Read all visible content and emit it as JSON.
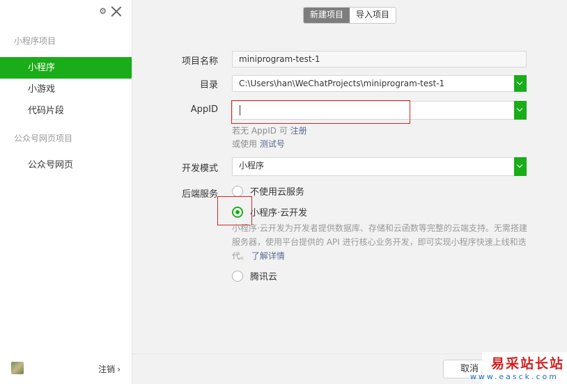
{
  "sidebar": {
    "gear_icon": "⚙",
    "sections": [
      {
        "title": "小程序项目",
        "items": [
          "小程序",
          "小游戏",
          "代码片段"
        ]
      },
      {
        "title": "公众号网页项目",
        "items": [
          "公众号网页"
        ]
      }
    ],
    "active_item": "小程序",
    "logout_label": "注销",
    "logout_chevron": "›"
  },
  "tabs": [
    {
      "label": "新建项目",
      "active": true
    },
    {
      "label": "导入项目",
      "active": false
    }
  ],
  "form": {
    "project_name_label": "项目名称",
    "project_name_value": "miniprogram-test-1",
    "directory_label": "目录",
    "directory_value": "C:\\Users\\han\\WeChatProjects\\miniprogram-test-1",
    "appid_label": "AppID",
    "appid_value": "",
    "appid_hint1_prefix": "若无 AppID 可",
    "appid_hint1_link": "注册",
    "appid_hint2_prefix": "或使用",
    "appid_hint2_link": "测试号",
    "dev_mode_label": "开发模式",
    "dev_mode_value": "小程序",
    "backend_label": "后端服务",
    "backend_options": [
      {
        "label": "不使用云服务",
        "checked": false
      },
      {
        "label": "小程序·云开发",
        "checked": true
      },
      {
        "label": "腾讯云",
        "checked": false
      }
    ],
    "cloud_desc": "小程序·云开发为开发者提供数据库、存储和云函数等完整的云端支持。无需搭建服务器，使用平台提供的 API 进行核心业务开发，即可实现小程序快速上线和迭代。",
    "cloud_desc_link": "了解详情"
  },
  "footer": {
    "cancel_label": "取消"
  },
  "watermark": {
    "line1": "易采站长站",
    "line2": "www.easck.com"
  },
  "colors": {
    "accent": "#1aad19",
    "link": "#576b95",
    "highlight": "#e02020"
  }
}
